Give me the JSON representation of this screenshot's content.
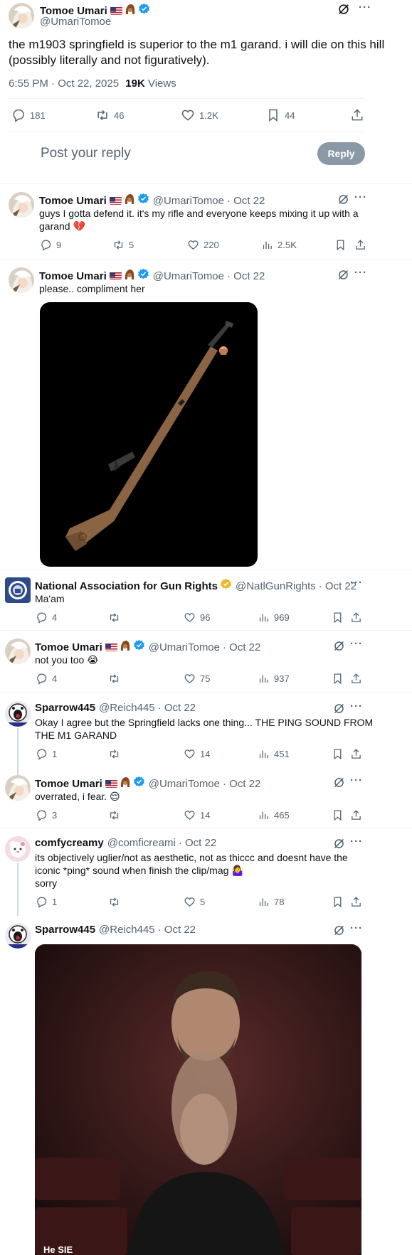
{
  "main_tweet": {
    "author_name": "Tomoe Umari",
    "handle": "@UmariTomoe",
    "text_line1": "the m1903 springfield is superior to the m1 garand. i will die on this hill",
    "text_line2": "(possibly literally and not figuratively).",
    "timestamp": "6:55 PM · Oct 22, 2025",
    "views_count": "19K",
    "views_label": "Views",
    "replies": "181",
    "reposts": "46",
    "likes": "1.2K",
    "bookmarks": "44"
  },
  "reply_box": {
    "placeholder": "Post your reply",
    "button": "Reply"
  },
  "replies": [
    {
      "name": "Tomoe Umari",
      "handle": "@UmariTomoe",
      "date": "· Oct 22",
      "line1": "guys I gotta defend it. it's my rifle and everyone keeps mixing it up with a",
      "line2": "garand 💔",
      "replies": "9",
      "reposts": "5",
      "likes": "220",
      "views": "2.5K"
    },
    {
      "name": "Tomoe Umari",
      "handle": "@UmariTomoe",
      "date": "· Oct 22",
      "line1": "please.. compliment her"
    },
    {
      "name": "National Association for Gun Rights",
      "handle": "@NatlGunRights",
      "date": "· Oct 22",
      "line1": "Ma'am",
      "replies": "4",
      "reposts": "",
      "likes": "96",
      "views": "969"
    },
    {
      "name": "Tomoe Umari",
      "handle": "@UmariTomoe",
      "date": "· Oct 22",
      "line1": "not you too 😭",
      "replies": "4",
      "reposts": "",
      "likes": "75",
      "views": "937"
    },
    {
      "name": "Sparrow445",
      "handle": "@Reich445",
      "date": "· Oct 22",
      "line1": "Okay I agree but the Springfield lacks one thing... THE PING SOUND FROM",
      "line2": "THE M1 GARAND",
      "replies": "1",
      "reposts": "",
      "likes": "14",
      "views": "451"
    },
    {
      "name": "Tomoe Umari",
      "handle": "@UmariTomoe",
      "date": "· Oct 22",
      "line1": "overrated, i fear. 😌",
      "replies": "3",
      "reposts": "",
      "likes": "14",
      "views": "465"
    },
    {
      "name": "comfycreamy",
      "handle": "@comficreami",
      "date": "· Oct 22",
      "line1": "its objectively uglier/not as aesthetic, not as thiccc and doesnt have the",
      "line2": "iconic *ping* sound when finish the clip/mag 🤷‍♀️",
      "line3": "sorry",
      "replies": "1",
      "reposts": "",
      "likes": "5",
      "views": "78"
    },
    {
      "name": "Sparrow445",
      "handle": "@Reich445",
      "date": "· Oct 22",
      "gif_caption": "He SIE"
    }
  ],
  "colors": {
    "accent": "#1d9bf0",
    "muted": "#536471",
    "reply_button": "#8b98a5",
    "gold_badge": "#e8b829"
  }
}
